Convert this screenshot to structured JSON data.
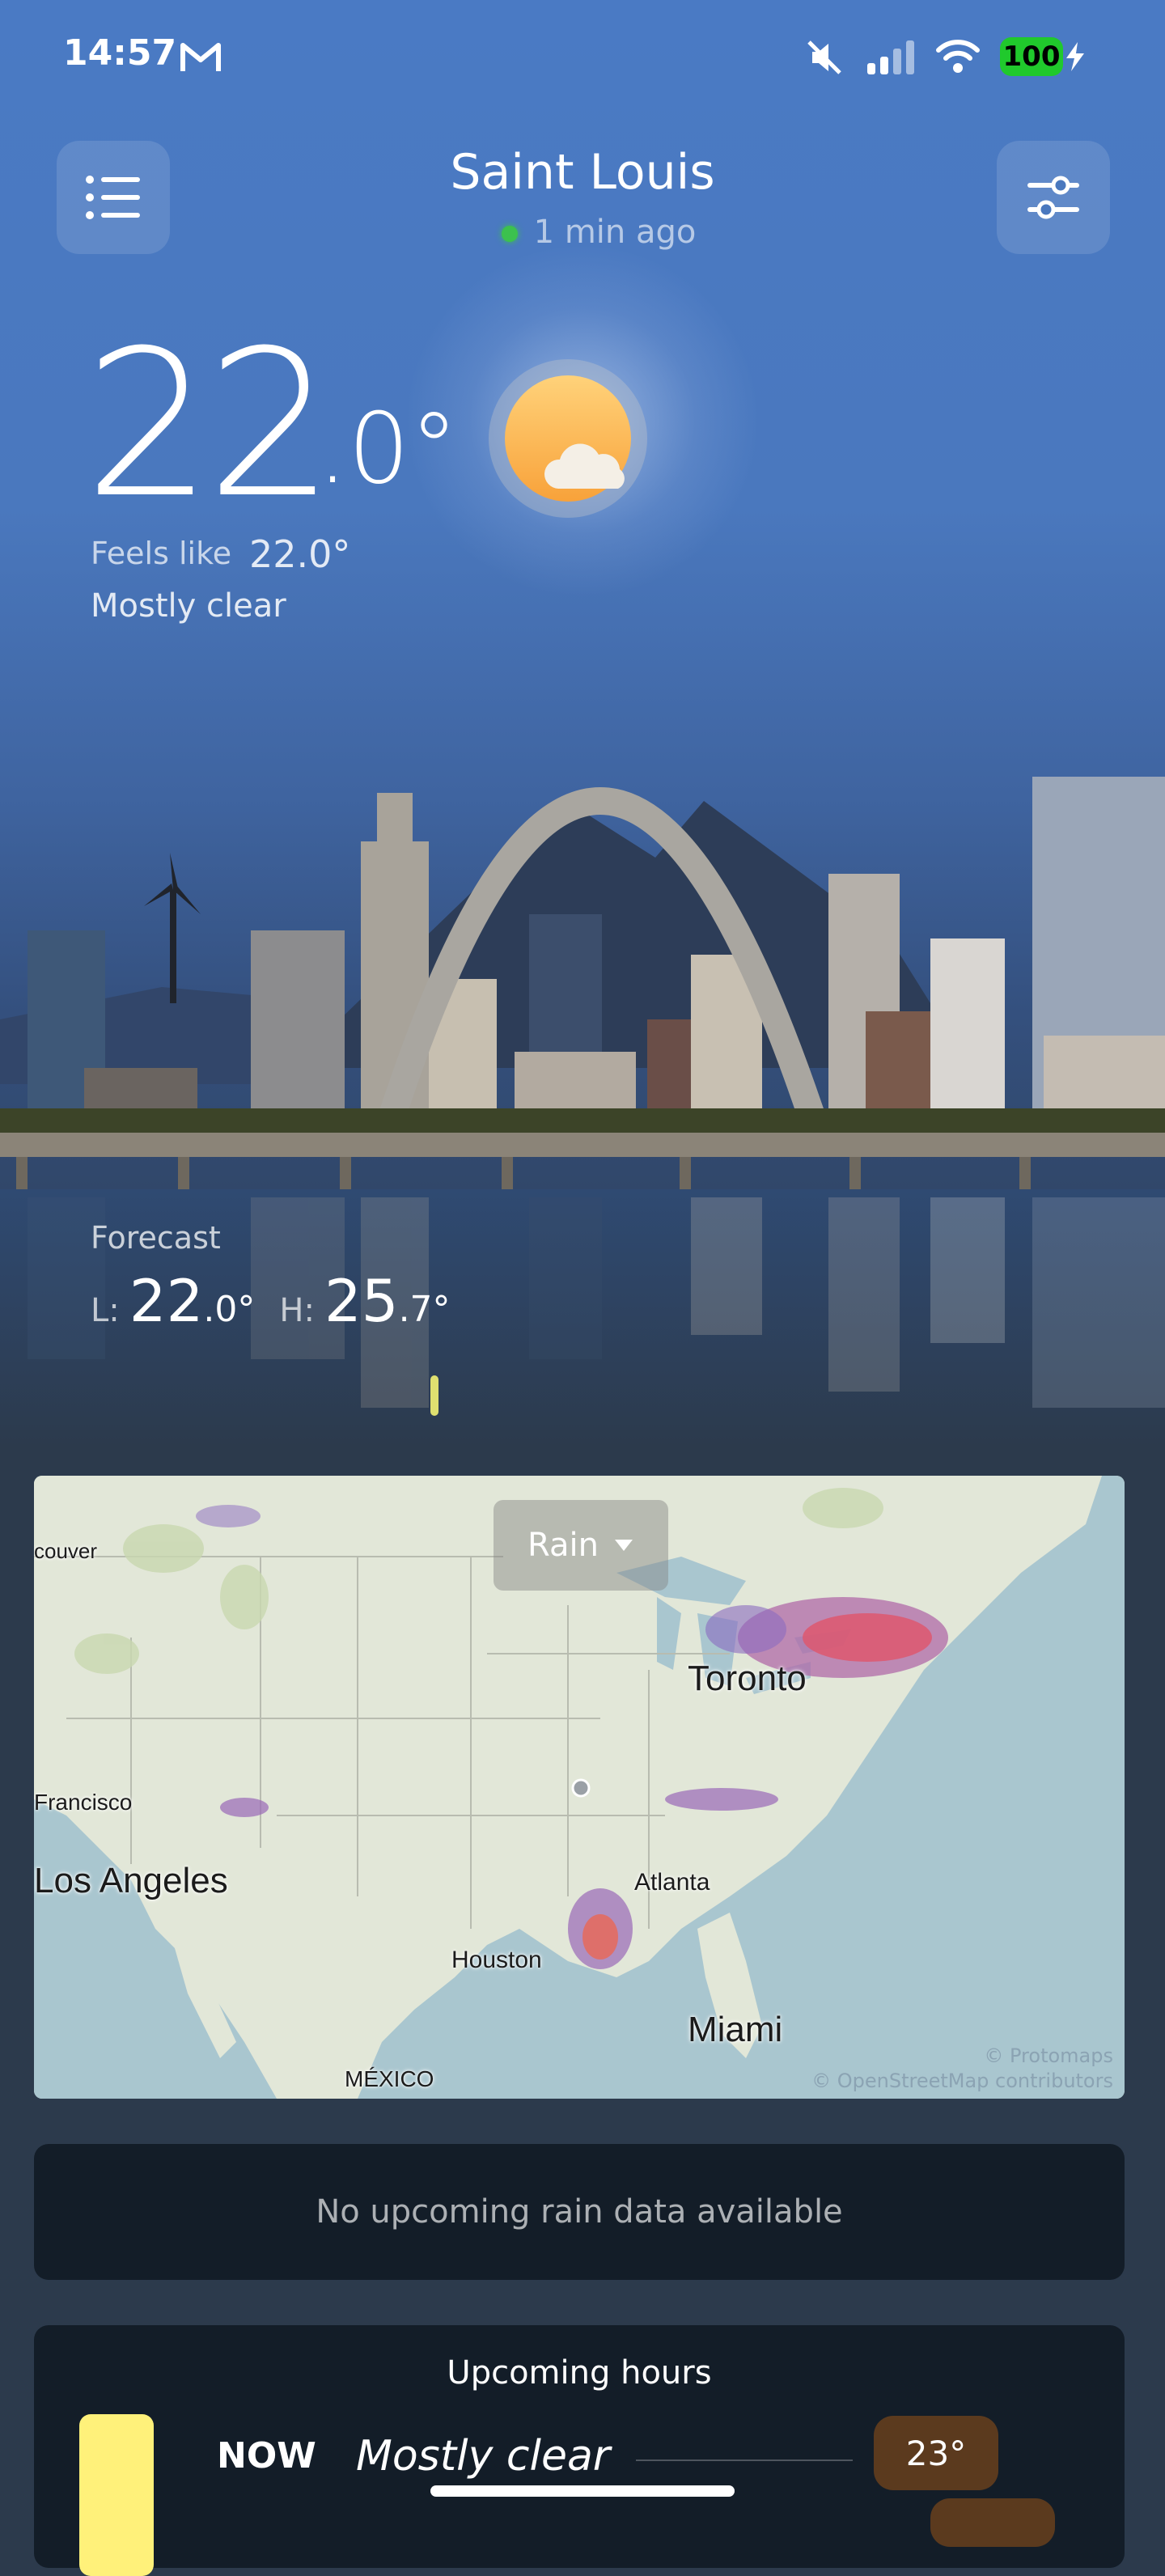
{
  "status_bar": {
    "time": "14:57",
    "battery": "100"
  },
  "header": {
    "city": "Saint Louis",
    "updated": "1 min ago"
  },
  "current": {
    "temp_whole": "22",
    "temp_decimal": ".0°",
    "feels_like_label": "Feels like",
    "feels_like_value": "22.0°",
    "condition": "Mostly clear",
    "icon": "sun-with-cloud-icon"
  },
  "forecast": {
    "label": "Forecast",
    "low_label": "L:",
    "low_whole": "22",
    "low_decimal": ".0°",
    "high_label": "H:",
    "high_whole": "25",
    "high_decimal": ".7°"
  },
  "map": {
    "layer_selected": "Rain",
    "labels": {
      "vancouver": "couver",
      "toronto": "Toronto",
      "san_francisco": "Francisco",
      "los_angeles": "Los Angeles",
      "atlanta": "Atlanta",
      "houston": "Houston",
      "miami": "Miami",
      "mexico": "MÉXICO"
    },
    "attribution_1": "© Protomaps",
    "attribution_2": "© OpenStreetMap contributors"
  },
  "rain_notice": "No upcoming rain data available",
  "upcoming": {
    "title": "Upcoming hours",
    "rows": [
      {
        "time": "NOW",
        "condition": "Mostly clear",
        "temp": "23°"
      }
    ]
  },
  "colors": {
    "sky_top": "#4a7ac4",
    "card_bg": "#131d28",
    "now_bar": "#fff17a",
    "temp_badge": "#5b3a1e",
    "battery": "#20c92c"
  }
}
